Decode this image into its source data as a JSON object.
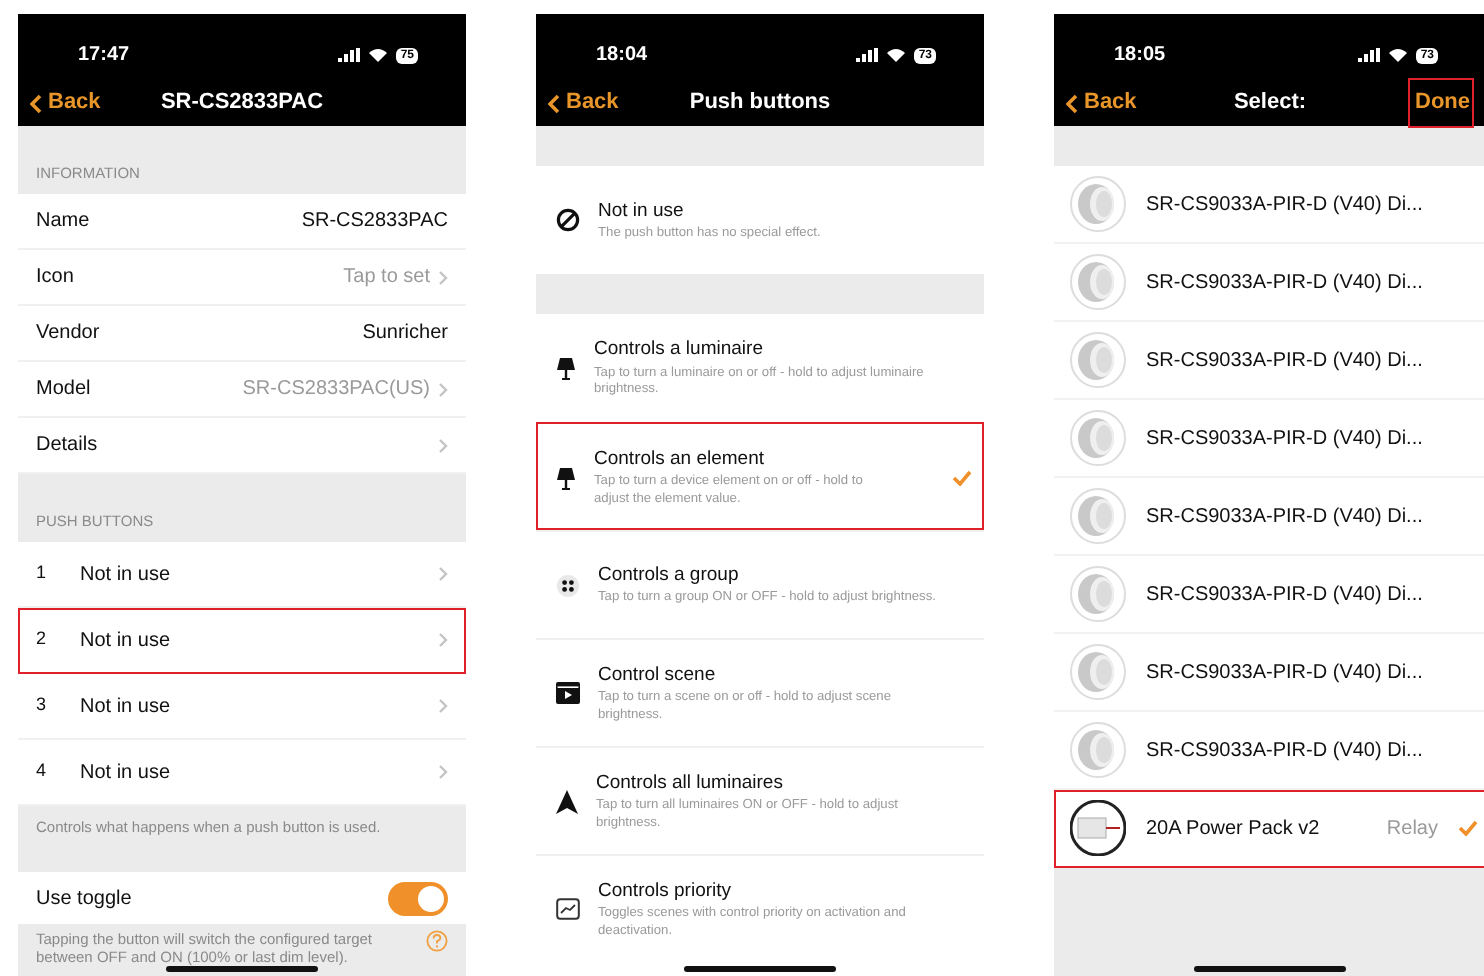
{
  "screens": [
    {
      "kind": "device",
      "status": {
        "time": "17:47",
        "battery": "75"
      },
      "nav": {
        "back": "Back",
        "title": "SR-CS2833PAC"
      },
      "information": {
        "header": "INFORMATION",
        "rows": [
          {
            "label": "Name",
            "value": "SR-CS2833PAC",
            "chevron": false
          },
          {
            "label": "Icon",
            "value": "Tap to set",
            "chevron": true
          },
          {
            "label": "Vendor",
            "value": "Sunricher",
            "chevron": false
          },
          {
            "label": "Model",
            "value": "SR-CS2833PAC(US)",
            "chevron": true
          },
          {
            "label": "Details",
            "chevron": true
          }
        ]
      },
      "push_buttons": {
        "header": "PUSH BUTTONS",
        "rows": [
          {
            "number": "1",
            "label": "Not in use",
            "highlighted": false
          },
          {
            "number": "2",
            "label": "Not in use",
            "highlighted": true
          },
          {
            "number": "3",
            "label": "Not in use",
            "highlighted": false
          },
          {
            "number": "4",
            "label": "Not in use",
            "highlighted": false
          }
        ],
        "footer": "Controls what happens when a push button is used."
      },
      "toggle": {
        "label": "Use toggle",
        "on": true
      },
      "toggle_note": "Tapping the button will switch the configured target between OFF and ON (100% or last dim level)."
    },
    {
      "kind": "options",
      "status": {
        "time": "18:04",
        "battery": "73"
      },
      "nav": {
        "back": "Back",
        "title": "Push buttons"
      },
      "groups": [
        [
          {
            "kind": "none",
            "title": "Not in use",
            "description": "The push button has no special effect.",
            "checked": false,
            "highlighted": false
          }
        ],
        [
          {
            "kind": "lamp",
            "title": "Controls a luminaire",
            "description": "Tap to turn a luminaire on or off - hold to adjust luminaire brightness.",
            "checked": false,
            "highlighted": false
          },
          {
            "kind": "lamp",
            "title": "Controls an element",
            "description": "Tap to turn a device element on or off - hold to adjust the element value.",
            "checked": true,
            "highlighted": true
          },
          {
            "kind": "group",
            "title": "Controls a group",
            "description": "Tap to turn a group ON or OFF - hold to adjust brightness.",
            "checked": false,
            "highlighted": false
          },
          {
            "kind": "scene",
            "title": "Control scene",
            "description": "Tap to turn a scene on or off - hold to adjust scene brightness.",
            "checked": false,
            "highlighted": false
          },
          {
            "kind": "all",
            "title": "Controls all luminaires",
            "description": "Tap to turn all luminaires ON or OFF - hold to adjust brightness.",
            "checked": false,
            "highlighted": false
          },
          {
            "kind": "priority",
            "title": "Controls priority",
            "description": "Toggles scenes with control priority on activation and deactivation.",
            "checked": false,
            "highlighted": false
          }
        ]
      ]
    },
    {
      "kind": "select",
      "status": {
        "time": "18:05",
        "battery": "73"
      },
      "nav": {
        "back": "Back",
        "title": "Select:",
        "done": "Done",
        "done_highlighted": true
      },
      "items": [
        {
          "kind": "sensor",
          "name": "SR-CS9033A-PIR-D (V40) Di...",
          "checked": false,
          "highlighted": false
        },
        {
          "kind": "sensor",
          "name": "SR-CS9033A-PIR-D (V40) Di...",
          "checked": false,
          "highlighted": false
        },
        {
          "kind": "sensor",
          "name": "SR-CS9033A-PIR-D (V40) Di...",
          "checked": false,
          "highlighted": false
        },
        {
          "kind": "sensor",
          "name": "SR-CS9033A-PIR-D (V40) Di...",
          "checked": false,
          "highlighted": false
        },
        {
          "kind": "sensor",
          "name": "SR-CS9033A-PIR-D (V40) Di...",
          "checked": false,
          "highlighted": false
        },
        {
          "kind": "sensor",
          "name": "SR-CS9033A-PIR-D (V40) Di...",
          "checked": false,
          "highlighted": false
        },
        {
          "kind": "sensor",
          "name": "SR-CS9033A-PIR-D (V40) Di...",
          "checked": false,
          "highlighted": false
        },
        {
          "kind": "sensor",
          "name": "SR-CS9033A-PIR-D (V40) Di...",
          "checked": false,
          "highlighted": false
        },
        {
          "kind": "relay",
          "name": "20A Power Pack v2",
          "detail": "Relay",
          "checked": true,
          "highlighted": true
        }
      ]
    }
  ]
}
